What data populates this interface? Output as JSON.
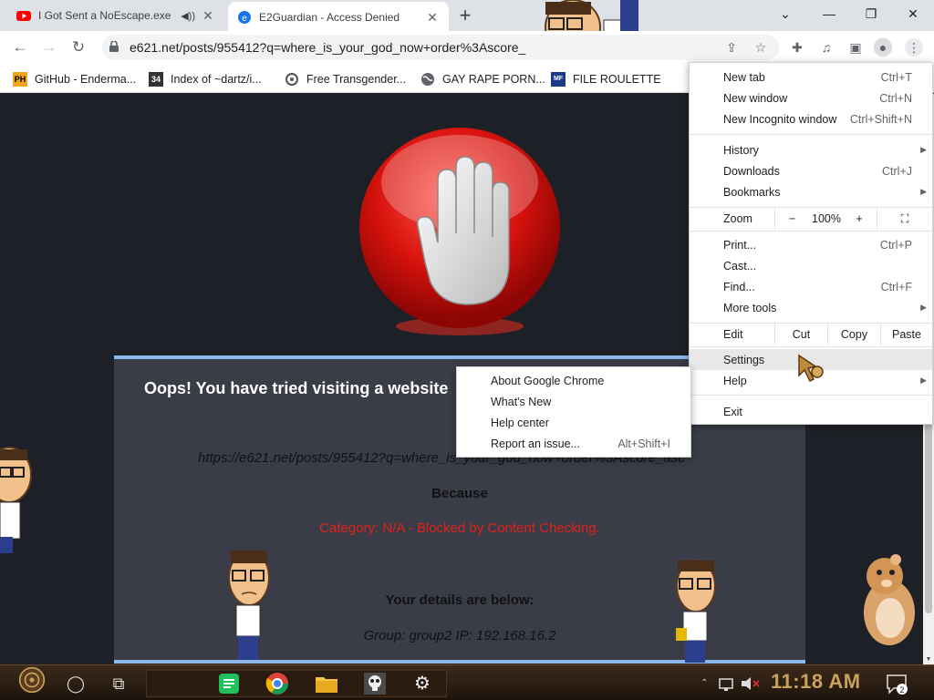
{
  "tabs": [
    {
      "title": "I Got Sent a NoEscape.exe",
      "audio": "◀))",
      "close": "✕"
    },
    {
      "title": "E2Guardian - Access Denied",
      "close": "✕"
    }
  ],
  "toolbar": {
    "url": "e621.net/posts/955412?q=where_is_your_god_now+order%3Ascore_"
  },
  "bookmarks": [
    {
      "label": "GitHub - Enderma...",
      "icon_text": "PH",
      "icon_color": "#f7a41d"
    },
    {
      "label": "Index of ~dartz/i...",
      "icon_text": "34",
      "icon_color": "#333333"
    },
    {
      "label": "Free Transgender...",
      "icon_text": "",
      "icon_color": "#555555"
    },
    {
      "label": "GAY RAPE PORN...",
      "icon_text": "",
      "icon_color": "#5f6368"
    },
    {
      "label": "FILE ROULETTE",
      "icon_text": "",
      "icon_color": "#1a3a8a"
    }
  ],
  "block_page": {
    "headline": "Oops! You have tried visiting a website",
    "blocked_url": "https://e621.net/posts/955412?q=where_is_your_god_now+order%3Ascore_asc",
    "because": "Because",
    "category": "Category: N/A - Blocked by Content Checking.",
    "details_heading": "Your details are below:",
    "group_ip": "Group: group2   IP: 192.168.16.2"
  },
  "chrome_menu": {
    "new_tab": {
      "label": "New tab",
      "shortcut": "Ctrl+T"
    },
    "new_window": {
      "label": "New window",
      "shortcut": "Ctrl+N"
    },
    "incognito": {
      "label": "New Incognito window",
      "shortcut": "Ctrl+Shift+N"
    },
    "history": {
      "label": "History"
    },
    "downloads": {
      "label": "Downloads",
      "shortcut": "Ctrl+J"
    },
    "bookmarks": {
      "label": "Bookmarks"
    },
    "zoom": {
      "label": "Zoom",
      "minus": "−",
      "level": "100%",
      "plus": "+"
    },
    "print": {
      "label": "Print...",
      "shortcut": "Ctrl+P"
    },
    "cast": {
      "label": "Cast..."
    },
    "find": {
      "label": "Find...",
      "shortcut": "Ctrl+F"
    },
    "more_tools": {
      "label": "More tools"
    },
    "edit": {
      "label": "Edit",
      "cut": "Cut",
      "copy": "Copy",
      "paste": "Paste"
    },
    "settings": {
      "label": "Settings"
    },
    "help": {
      "label": "Help"
    },
    "exit": {
      "label": "Exit"
    }
  },
  "help_menu": {
    "about": {
      "label": "About Google Chrome"
    },
    "whats_new": {
      "label": "What's New"
    },
    "help_center": {
      "label": "Help center"
    },
    "report": {
      "label": "Report an issue...",
      "shortcut": "Alt+Shift+I"
    }
  },
  "taskbar": {
    "clock": "11:18 AM",
    "notification_count": "2"
  },
  "colors": {
    "page_bg": "#1d2026",
    "panel_bg": "#3a3d47",
    "panel_border": "#8bb8e8",
    "category_red": "#e0211c",
    "taskbar_bg": "#2a1d12",
    "clock_gold": "#c9a25a"
  },
  "icons": [
    "youtube-icon",
    "e2guardian-icon",
    "audio-icon",
    "share-icon",
    "star-icon",
    "extensions-icon",
    "media-icon",
    "sidepanel-icon",
    "profile-icon",
    "kebab-menu-icon",
    "lock-icon",
    "back-icon",
    "forward-icon",
    "reload-icon",
    "fullscreen-icon",
    "stop-hand-icon",
    "chrome-icon",
    "folder-icon",
    "skull-icon",
    "gear-icon",
    "task-view-icon",
    "cortana-icon",
    "network-icon",
    "volume-muted-icon",
    "notification-icon"
  ]
}
